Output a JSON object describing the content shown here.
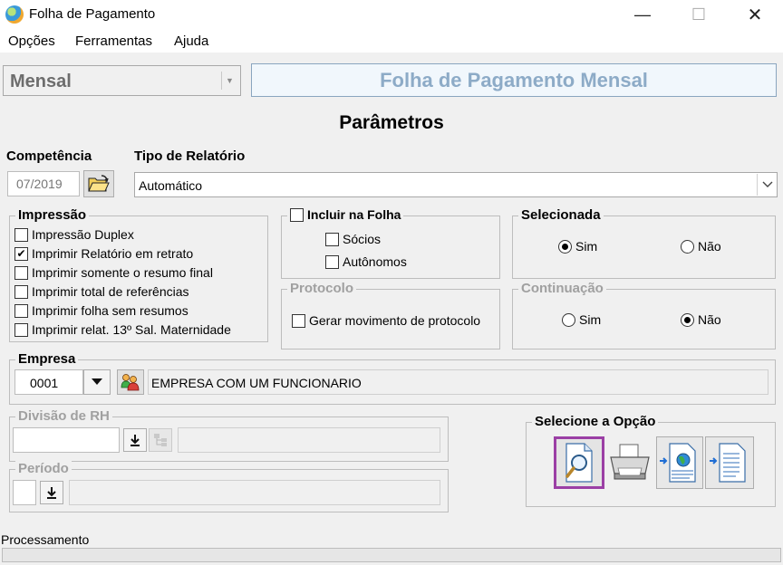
{
  "window": {
    "title": "Folha de Pagamento",
    "minimize_glyph": "—",
    "maximize_glyph": "☐",
    "close_glyph": "✕",
    "icon": "app-globe-icon"
  },
  "menu": {
    "items": [
      "Opções",
      "Ferramentas",
      "Ajuda"
    ]
  },
  "top": {
    "tipo_folha": "Mensal",
    "banner": "Folha de Pagamento Mensal"
  },
  "params": {
    "title": "Parâmetros",
    "competencia_label": "Competência",
    "competencia_value": "07/2019",
    "tipo_relatorio_label": "Tipo de Relatório",
    "tipo_relatorio_value": "Automático"
  },
  "impressao": {
    "title": "Impressão",
    "options": [
      {
        "label": "Impressão Duplex",
        "checked": false
      },
      {
        "label": "Imprimir Relatório em retrato",
        "checked": true
      },
      {
        "label": "Imprimir somente o resumo final",
        "checked": false
      },
      {
        "label": "Imprimir total de referências",
        "checked": false
      },
      {
        "label": "Imprimir folha sem resumos",
        "checked": false
      },
      {
        "label": "Imprimir relat. 13º Sal. Maternidade",
        "checked": false
      }
    ]
  },
  "incluir": {
    "title": "Incluir na Folha",
    "checked": false,
    "options": [
      {
        "label": "Sócios",
        "checked": false
      },
      {
        "label": "Autônomos",
        "checked": false
      }
    ]
  },
  "selecionada": {
    "title": "Selecionada",
    "sim": "Sim",
    "nao": "Não",
    "selected": "Sim"
  },
  "protocolo": {
    "title": "Protocolo",
    "option": "Gerar movimento de protocolo",
    "checked": false
  },
  "continuacao": {
    "title": "Continuação",
    "sim": "Sim",
    "nao": "Não",
    "selected": "Não"
  },
  "empresa": {
    "title": "Empresa",
    "code": "0001",
    "name": "EMPRESA COM UM FUNCIONARIO"
  },
  "divisao": {
    "title": "Divisão de RH",
    "value": ""
  },
  "periodo": {
    "title": "Período",
    "value": ""
  },
  "opcao": {
    "title": "Selecione a Opção",
    "buttons": [
      "preview-icon",
      "printer-icon",
      "export-web-icon",
      "export-document-icon"
    ],
    "selected": "preview-icon",
    "highlight_color": "#9b3fa5"
  },
  "status": {
    "processamento_label": "Processamento",
    "progress": 0
  }
}
